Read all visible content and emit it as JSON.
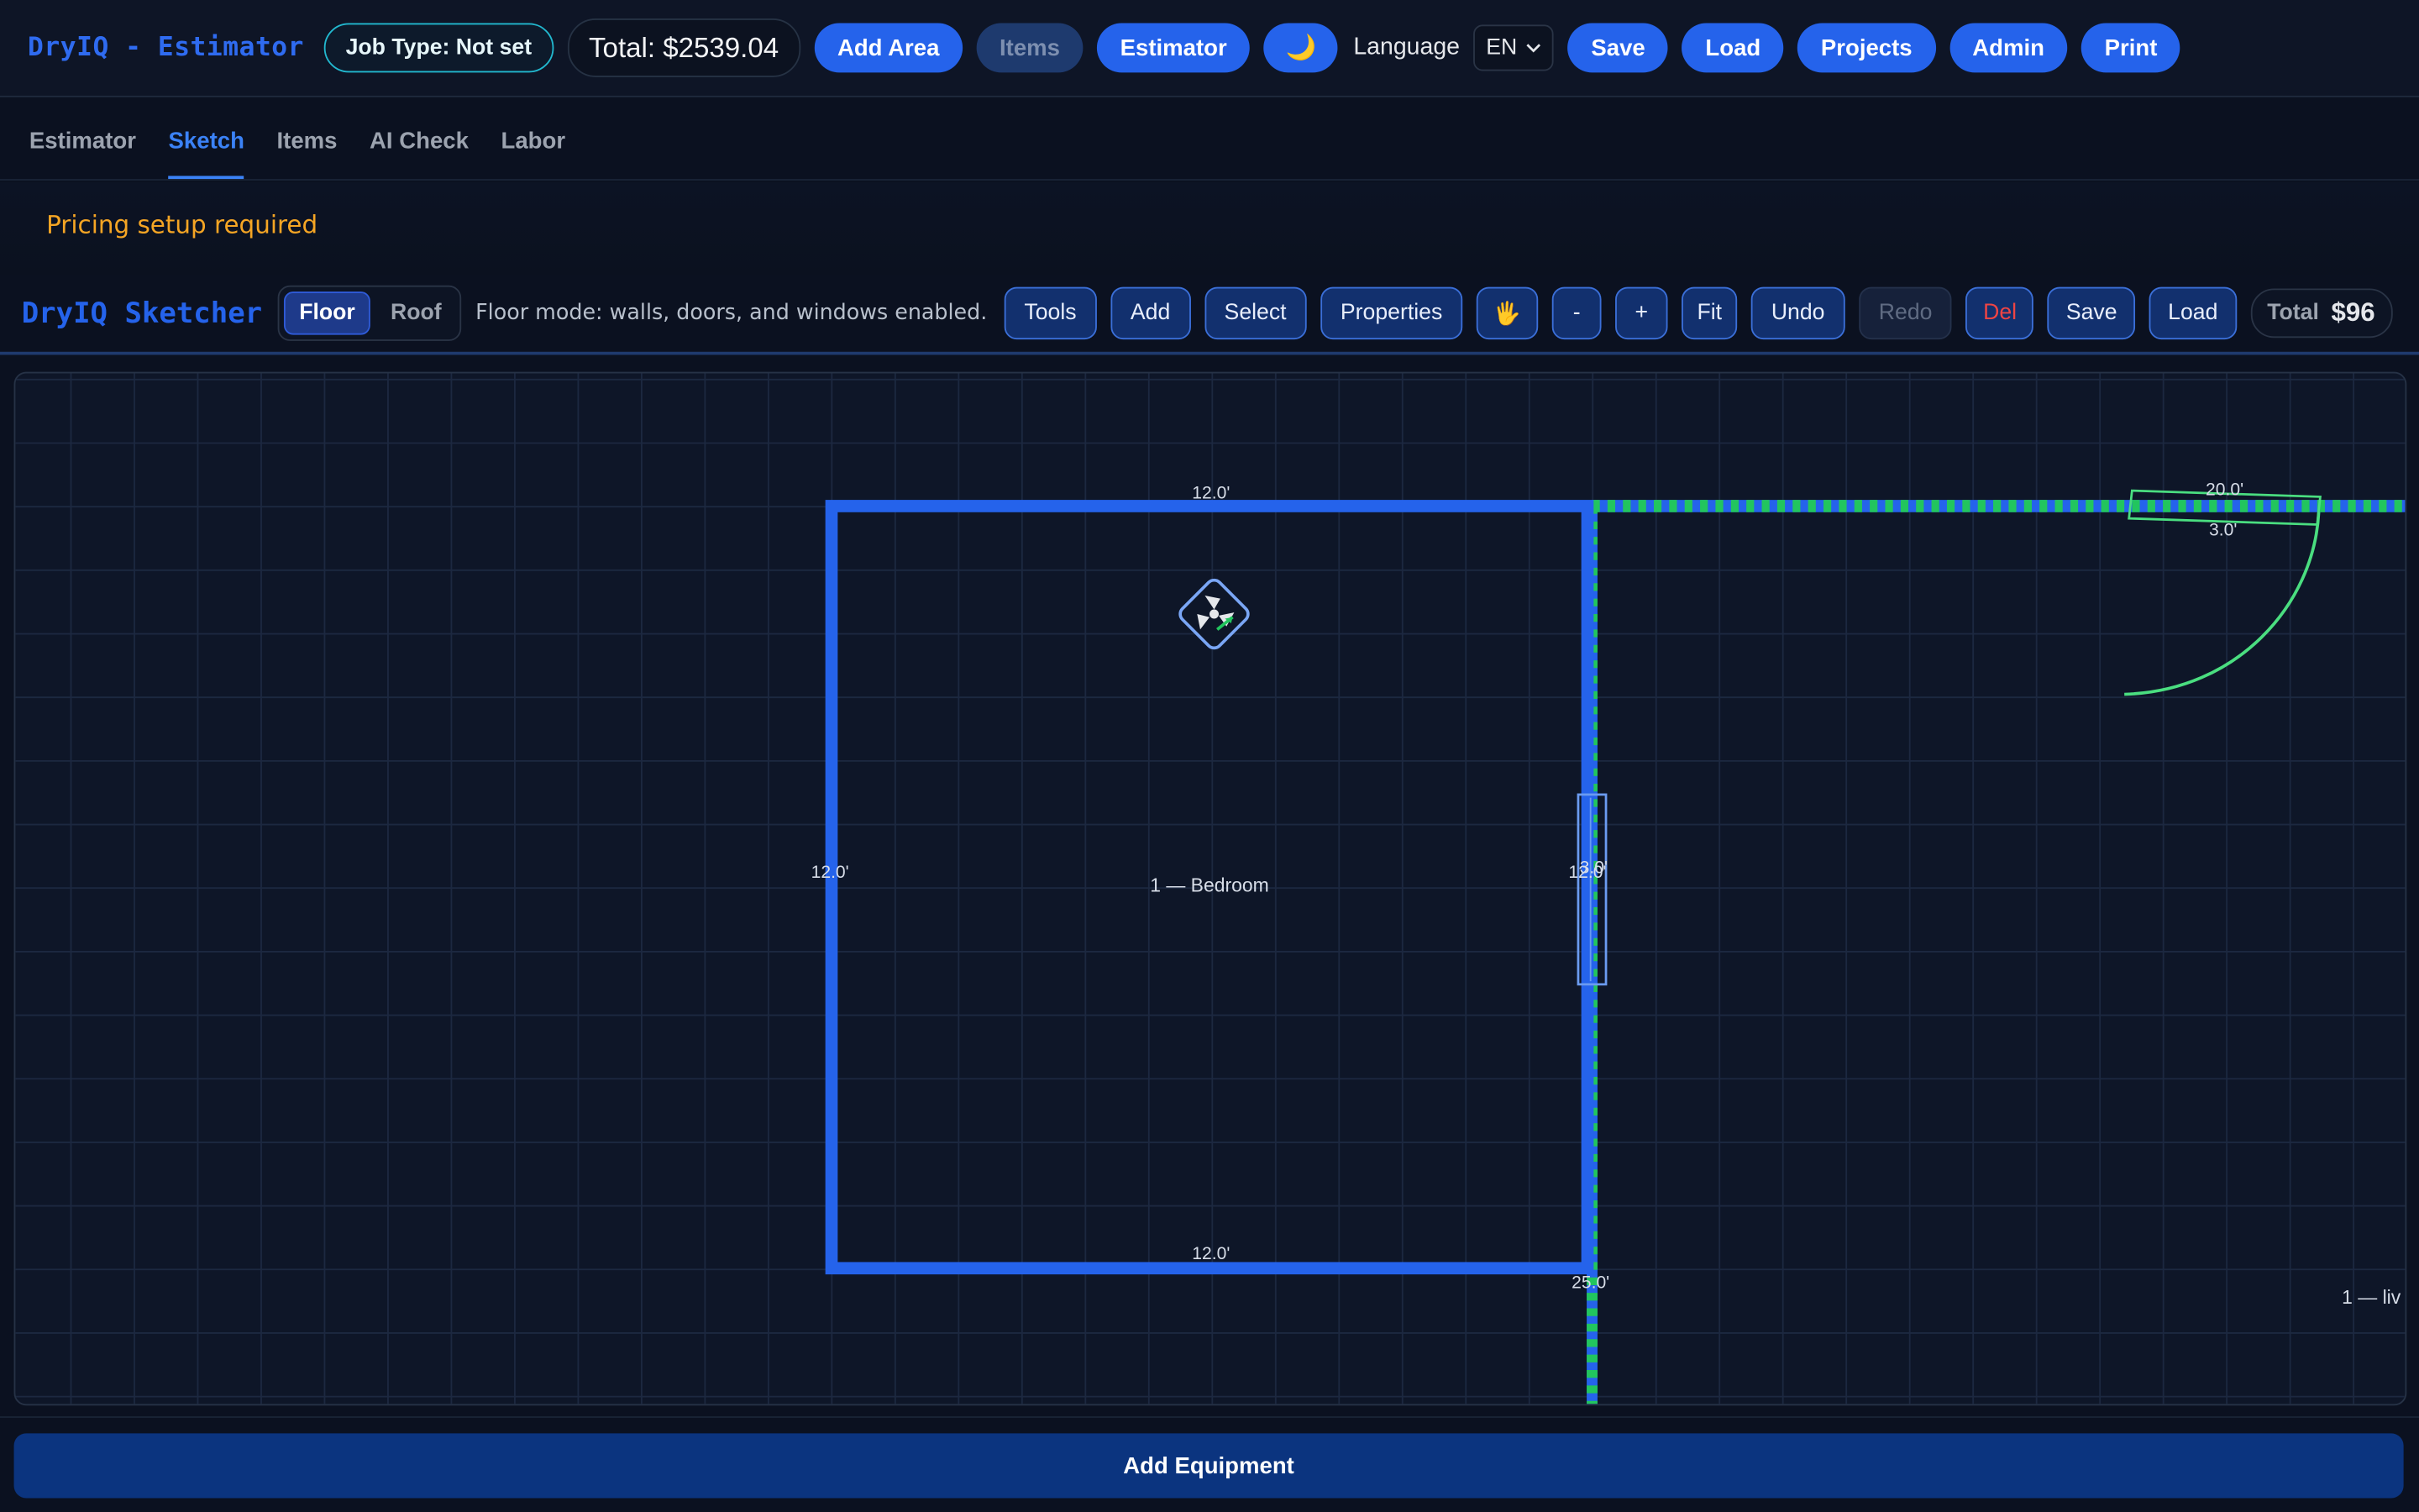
{
  "app": {
    "title": "DryIQ - Estimator",
    "job_type": "Job Type: Not set",
    "total": "Total: $2539.04"
  },
  "topbar": {
    "add_area": "Add Area",
    "items": "Items",
    "estimator": "Estimator",
    "theme_icon": "🌙",
    "language_label": "Language",
    "language_value": "EN",
    "save": "Save",
    "load": "Load",
    "projects": "Projects",
    "admin": "Admin",
    "print": "Print"
  },
  "tabs": [
    "Estimator",
    "Sketch",
    "Items",
    "AI Check",
    "Labor"
  ],
  "active_tab": "Sketch",
  "notice": "Pricing setup required",
  "sketcher": {
    "title": "DryIQ Sketcher",
    "modes": [
      "Floor",
      "Roof"
    ],
    "active_mode": "Floor",
    "hint": "Floor mode: walls, doors, and windows enabled.",
    "buttons": {
      "tools": "Tools",
      "add": "Add",
      "select": "Select",
      "properties": "Properties",
      "pan_icon": "🖐",
      "zoom_out": "-",
      "zoom_in": "+",
      "fit": "Fit",
      "undo": "Undo",
      "redo": "Redo",
      "del": "Del",
      "save": "Save",
      "load": "Load"
    },
    "total_label": "Total",
    "total_value": "$96"
  },
  "canvas": {
    "labels": {
      "room1_top": "12.0'",
      "room1_left": "12.0'",
      "room1_right": "12.0'",
      "room1_bottom": "12.0'",
      "room1_name": "1 — Bedroom",
      "window_len": "3.0'",
      "room2_top": "20.0'",
      "door_len": "3.0'",
      "room2_left": "25.0'",
      "room2_name": "1 — liv"
    },
    "colors": {
      "wall_selected": "#2563eb",
      "wall_adjacent": "#22c55e",
      "grid": "#1c2840"
    }
  },
  "footer": {
    "add_equipment": "Add Equipment"
  }
}
